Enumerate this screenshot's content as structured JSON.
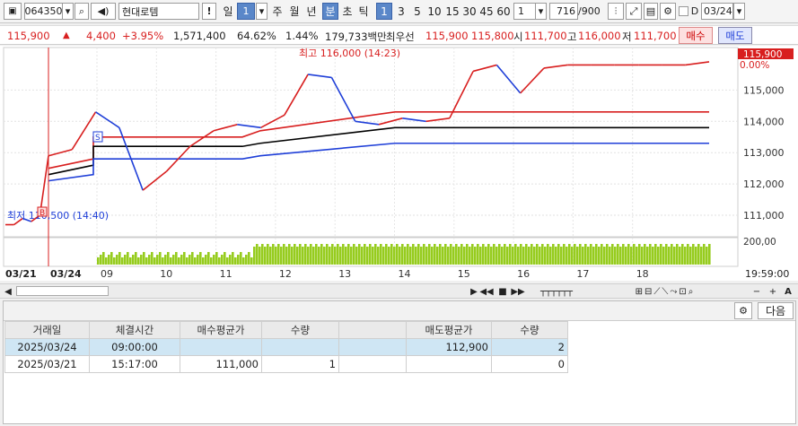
{
  "toolbar": {
    "code": "064350",
    "name": "현대로템",
    "exclaim": "!",
    "period_day": "일",
    "period_num": "1",
    "periods": [
      "주",
      "월",
      "년",
      "분",
      "초",
      "틱"
    ],
    "minute_options": [
      "1",
      "3",
      "5",
      "10",
      "15",
      "30",
      "45",
      "60"
    ],
    "selected_minute": "1",
    "count_display": "716",
    "count_total": "/900",
    "date": "03/24",
    "d_label": "D"
  },
  "quote": {
    "price": "115,900",
    "change_arrow": "▲",
    "change": "4,400",
    "change_pct": "+3.95%",
    "volume": "1,571,400",
    "vol_ratio": "64.62%",
    "turnover_ratio": "1.44%",
    "amount": "179,733백만",
    "best_label": "최우선",
    "best_ask": "115,900",
    "best_bid": "115,800",
    "open_label": "시",
    "open": "111,700",
    "high_label": "고",
    "high": "116,000",
    "low_label": "저",
    "low": "111,700",
    "buy_button": "매수",
    "sell_button": "매도"
  },
  "chart_labels": {
    "high_note": "최고 116,000 (14:23)",
    "low_note": "최저 110,500 (14:40)",
    "last_price_tag": "115,900",
    "pct_tag": "0.00%",
    "buy_marker": "B",
    "sell_marker": "S",
    "volume_axis_label": "200,00",
    "date_left": "03/21",
    "date_right": "03/24",
    "time_end": "19:59:00"
  },
  "chart_data": {
    "type": "line",
    "y_ticks": [
      115000,
      114000,
      113000,
      112000,
      111000
    ],
    "x_ticks": [
      "09",
      "10",
      "11",
      "12",
      "13",
      "14",
      "15",
      "16",
      "17",
      "18"
    ],
    "ylim": [
      110400,
      116300
    ],
    "high": 116000,
    "low": 110500,
    "last": 115900,
    "series": [
      {
        "name": "",
        "values": [
          110700,
          110700,
          110900,
          110800,
          111000,
          112900,
          113100,
          114300,
          113800,
          111800,
          112400,
          113200,
          113700,
          113900,
          113800,
          114200,
          115500,
          115400,
          114000,
          113900,
          114100,
          114000,
          114100,
          115600,
          115800,
          114900,
          115700,
          115800,
          115800,
          115800,
          115800,
          115800,
          115800,
          115900
        ]
      }
    ],
    "bands": [
      {
        "name": "",
        "color": "#d81f1f",
        "values": [
          112500,
          112800,
          113500,
          113500,
          113700,
          114300,
          114300,
          114300
        ]
      },
      {
        "name": "",
        "color": "#000000",
        "values": [
          112300,
          112600,
          113200,
          113200,
          113300,
          113800,
          113800,
          113800
        ]
      },
      {
        "name": "",
        "color": "#1f3fd8",
        "values": [
          112100,
          112300,
          112800,
          112800,
          112900,
          113300,
          113300,
          113300
        ]
      }
    ]
  },
  "grid": {
    "next_button": "다음",
    "headers": [
      "거래일",
      "체결시간",
      "매수평균가",
      "수량",
      "",
      "매도평균가",
      "수량"
    ],
    "rows": [
      [
        "2025/03/24",
        "09:00:00",
        "",
        "",
        "",
        "112,900",
        "2"
      ],
      [
        "2025/03/21",
        "15:17:00",
        "111,000",
        "1",
        "",
        "",
        "0"
      ]
    ]
  }
}
